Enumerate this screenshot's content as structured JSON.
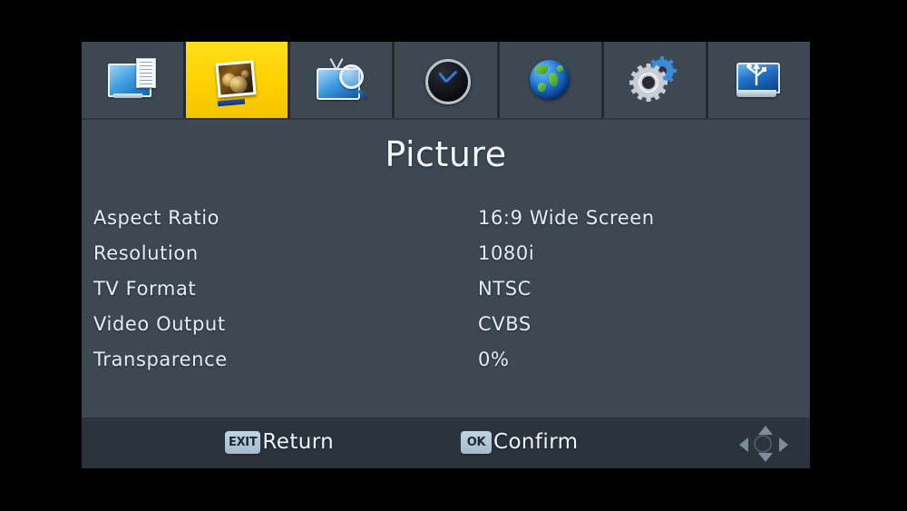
{
  "menu": {
    "tabs": [
      {
        "id": "program",
        "icon": "monitor-document-icon",
        "selected": false
      },
      {
        "id": "picture",
        "icon": "photo-icon",
        "selected": true
      },
      {
        "id": "search",
        "icon": "tv-magnifier-icon",
        "selected": false
      },
      {
        "id": "time",
        "icon": "clock-icon",
        "selected": false
      },
      {
        "id": "option",
        "icon": "globe-icon",
        "selected": false
      },
      {
        "id": "system",
        "icon": "gears-icon",
        "selected": false
      },
      {
        "id": "usb",
        "icon": "usb-drive-icon",
        "selected": false
      }
    ]
  },
  "page": {
    "title": "Picture"
  },
  "settings": [
    {
      "label": "Aspect Ratio",
      "value": "16:9 Wide Screen"
    },
    {
      "label": "Resolution",
      "value": "1080i"
    },
    {
      "label": "TV Format",
      "value": "NTSC"
    },
    {
      "label": "Video Output",
      "value": "CVBS"
    },
    {
      "label": "Transparence",
      "value": "0%"
    }
  ],
  "footer": {
    "return_key": "EXIT",
    "return_label": "Return",
    "confirm_key": "OK",
    "confirm_label": "Confirm",
    "navigation_icon": "dpad-icon"
  },
  "colors": {
    "panel_background": "#3d4852",
    "tabbar_background": "#333c45",
    "footer_background": "#2b333c",
    "selected_tab": "#ffd500",
    "text": "#e6edf2",
    "screen_background": "#000000"
  }
}
